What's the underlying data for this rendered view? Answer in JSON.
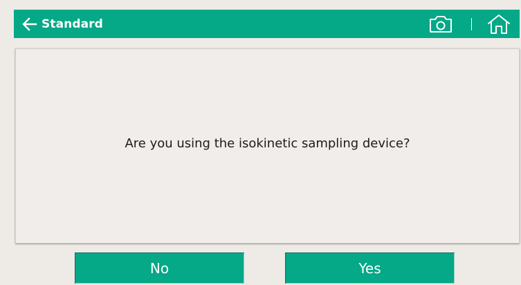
{
  "header": {
    "title": "Standard",
    "icons": {
      "back": "arrow-left-icon",
      "camera": "camera-icon",
      "home": "home-icon"
    }
  },
  "dialog": {
    "question": "Are you using the isokinetic sampling device?"
  },
  "buttons": {
    "no": "No",
    "yes": "Yes"
  },
  "colors": {
    "accent": "#05a887",
    "background": "#eeeae6",
    "dialog_background": "#f0edea",
    "text": "#1b1b1b"
  }
}
